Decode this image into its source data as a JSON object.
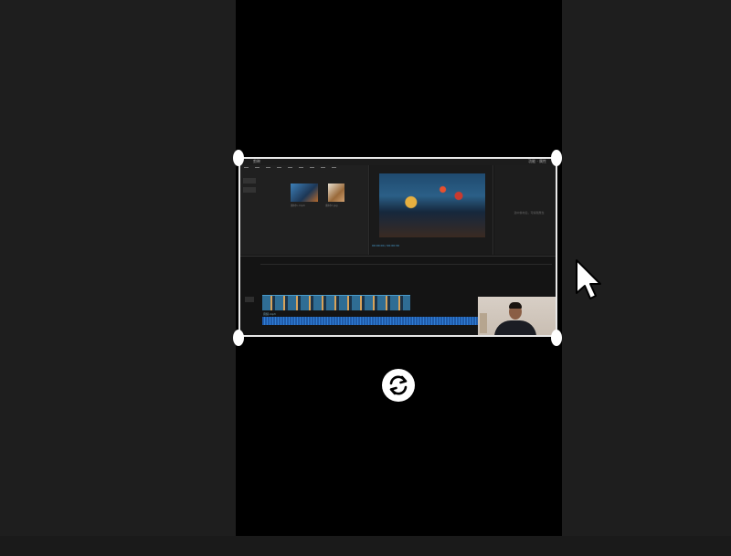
{
  "editor": {
    "title": "剪映",
    "title_right": "功能 · 属性",
    "media_labels": [
      "素材1.mp4",
      "素材2.jpg"
    ],
    "viewer_status": "00:00:00 / 00:00:30",
    "right_panel_hint": "选中素材后，可编辑属性",
    "audio_track_label": "音频.mp3"
  },
  "controls": {
    "rotate_icon": "rotate-arrows-icon"
  },
  "colors": {
    "canvas": "#000000",
    "workspace": "#1e1e1e",
    "frame_border": "#e8e8e8",
    "accent": "#4aa3d8"
  }
}
